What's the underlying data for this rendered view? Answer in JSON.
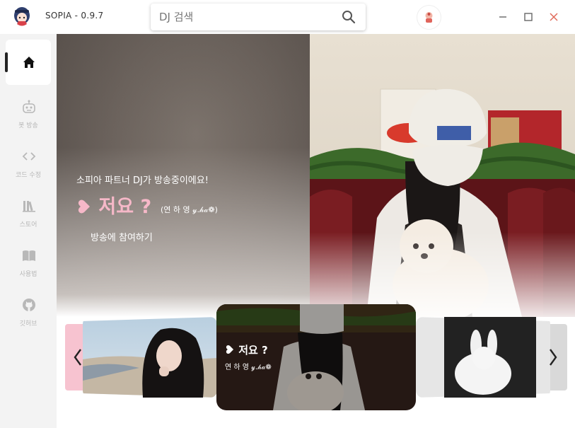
{
  "app": {
    "title": "SOPIA - 0.9.7"
  },
  "search": {
    "placeholder": "DJ 검색"
  },
  "sidebar": {
    "items": [
      {
        "label": "",
        "icon": "home-icon",
        "active": true
      },
      {
        "label": "봇 방송",
        "icon": "robot-icon",
        "active": false
      },
      {
        "label": "코드 수정",
        "icon": "code-icon",
        "active": false
      },
      {
        "label": "스토어",
        "icon": "library-icon",
        "active": false
      },
      {
        "label": "사용법",
        "icon": "book-icon",
        "active": false
      },
      {
        "label": "깃허브",
        "icon": "github-icon",
        "active": false
      }
    ]
  },
  "banner": {
    "broadcast_text": "소피아 파트너 DJ가 방송중이에요!",
    "dj_name": "저요 ?",
    "dj_subtitle": "(연 하 영 𝓎.𝒽𝒶❁)",
    "join_label": "방송에 참여하기"
  },
  "carousel": {
    "active_card": {
      "name": "저요 ?",
      "subtitle": "연 하 영 𝓎.𝒽𝒶❁"
    }
  },
  "colors": {
    "accent_pink": "#f6b8c8",
    "sidebar_bg": "#f3f3f3",
    "close_red": "#e06a5a"
  }
}
